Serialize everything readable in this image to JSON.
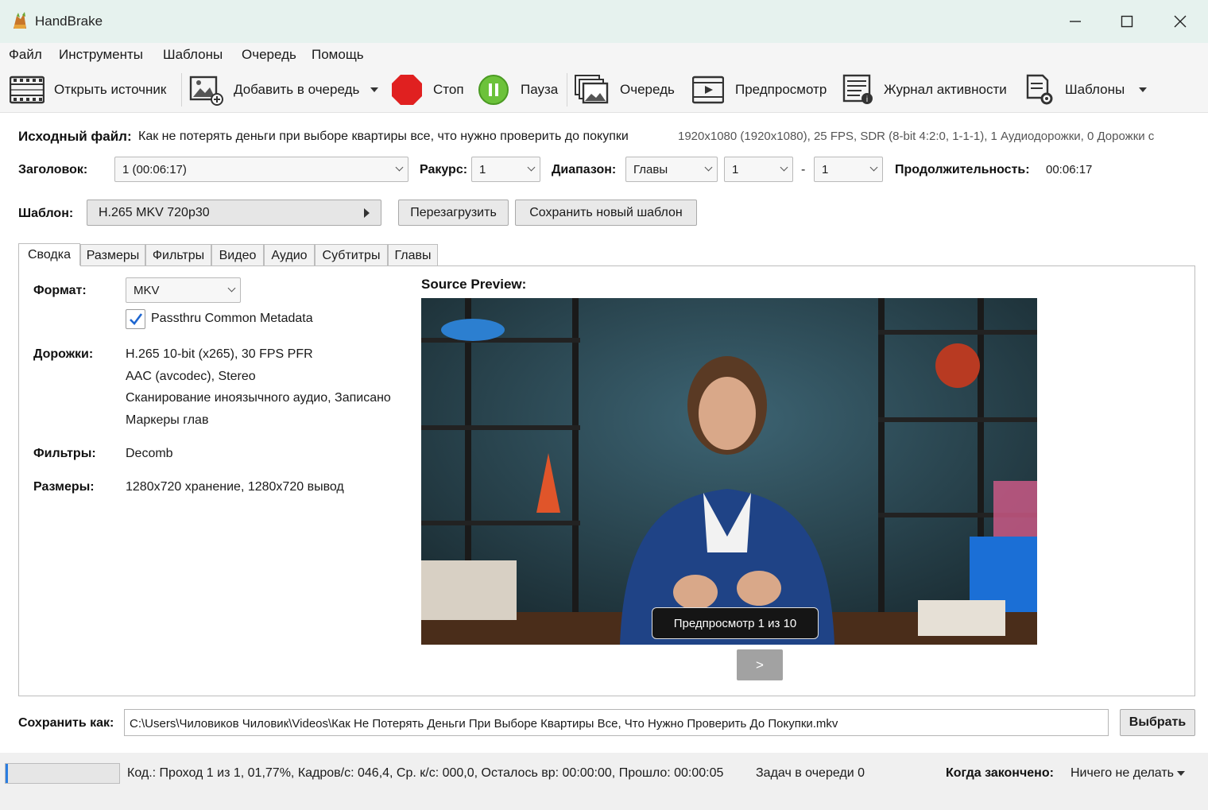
{
  "window": {
    "title": "HandBrake"
  },
  "menu": [
    "Файл",
    "Инструменты",
    "Шаблоны",
    "Очередь",
    "Помощь"
  ],
  "toolbar": {
    "open_source": "Открыть источник",
    "add_to_queue": "Добавить в очередь",
    "stop": "Стоп",
    "pause": "Пауза",
    "queue": "Очередь",
    "preview": "Предпросмотр",
    "activity_log": "Журнал активности",
    "presets": "Шаблоны"
  },
  "source": {
    "label": "Исходный файл:",
    "name": "Как не потерять деньги при выборе квартиры все, что нужно проверить до покупки",
    "info": "1920x1080 (1920x1080), 25 FPS, SDR (8-bit 4:2:0, 1-1-1), 1 Аудиодорожки, 0 Дорожки с"
  },
  "title_row": {
    "title_label": "Заголовок:",
    "title_value": "1  (00:06:17)",
    "angle_label": "Ракурс:",
    "angle_value": "1",
    "range_label": "Диапазон:",
    "range_type": "Главы",
    "range_start": "1",
    "range_sep": "-",
    "range_end": "1",
    "duration_label": "Продолжительность:",
    "duration_value": "00:06:17"
  },
  "preset_row": {
    "label": "Шаблон:",
    "value": "H.265 MKV 720p30",
    "reload": "Перезагрузить",
    "save_new": "Сохранить новый шаблон"
  },
  "tabs": [
    "Сводка",
    "Размеры",
    "Фильтры",
    "Видео",
    "Аудио",
    "Субтитры",
    "Главы"
  ],
  "summary": {
    "format_label": "Формат:",
    "format_value": "MKV",
    "passthru_label": "Passthru Common Metadata",
    "passthru_checked": true,
    "tracks_label": "Дорожки:",
    "tracks": [
      "H.265 10-bit (x265), 30 FPS PFR",
      "AAC (avcodec), Stereo",
      "Сканирование иноязычного аудио, Записано",
      "Маркеры глав"
    ],
    "filters_label": "Фильтры:",
    "filters_value": "Decomb",
    "size_label": "Размеры:",
    "size_value": "1280x720 хранение, 1280x720 вывод"
  },
  "preview": {
    "heading": "Source Preview:",
    "badge": "Предпросмотр 1 из 10",
    "next": ">"
  },
  "destination": {
    "label": "Сохранить как:",
    "path": "C:\\Users\\Чиловиков Чиловик\\Videos\\Как Не Потерять Деньги При Выборе Квартиры Все, Что Нужно Проверить До Покупки.mkv",
    "browse": "Выбрать"
  },
  "status": {
    "progress": 0.0177,
    "text": "Код.: Проход 1 из 1, 01,77%, Кадров/с: 046,4, Ср. к/с: 000,0, Осталось вр: 00:00:00, Прошло: 00:00:05",
    "queue_text": "Задач в очереди 0",
    "when_done_label": "Когда закончено:",
    "when_done_value": "Ничего не делать"
  },
  "colors": {
    "titlebar": "#e6f2ee",
    "stop": "#e02020",
    "pause": "#5cb82a",
    "preview_bg": "#2d4a55"
  }
}
